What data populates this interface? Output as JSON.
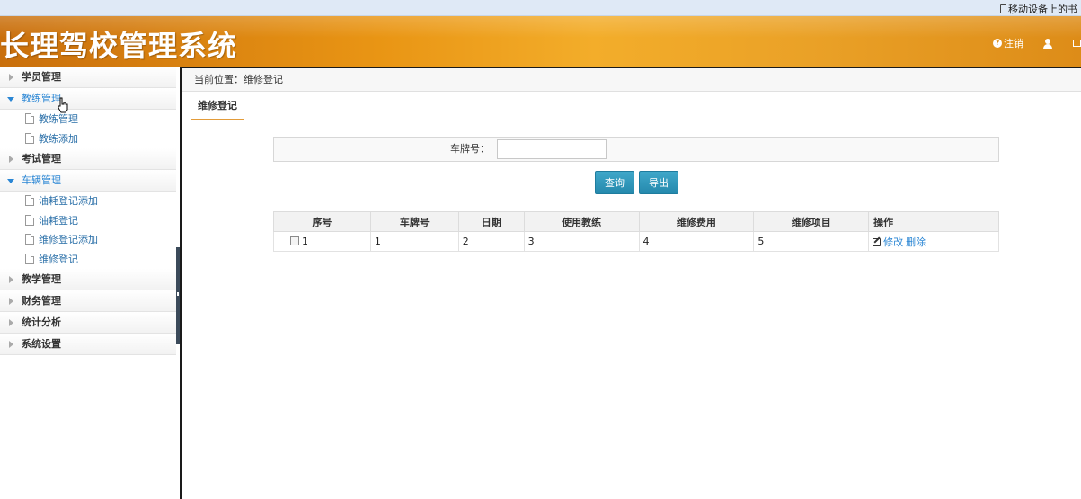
{
  "top_bar": {
    "mobile_link": "移动设备上的书"
  },
  "header": {
    "app_title": "长理驾校管理系统",
    "logout_label": "注销"
  },
  "sidebar": {
    "menus": [
      {
        "label": "学员管理",
        "open": false,
        "items": []
      },
      {
        "label": "教练管理",
        "open": true,
        "items": [
          "教练管理",
          "教练添加"
        ]
      },
      {
        "label": "考试管理",
        "open": false,
        "items": []
      },
      {
        "label": "车辆管理",
        "open": true,
        "items": [
          "油耗登记添加",
          "油耗登记",
          "维修登记添加",
          "维修登记"
        ]
      },
      {
        "label": "教学管理",
        "open": false,
        "items": []
      },
      {
        "label": "财务管理",
        "open": false,
        "items": []
      },
      {
        "label": "统计分析",
        "open": false,
        "items": []
      },
      {
        "label": "系统设置",
        "open": false,
        "items": []
      }
    ]
  },
  "main": {
    "breadcrumb": "当前位置：维修登记",
    "tab": "维修登记",
    "search": {
      "label": "车牌号：",
      "value": "",
      "placeholder": ""
    },
    "buttons": {
      "query": "查询",
      "export": "导出"
    },
    "table": {
      "headers": [
        "序号",
        "车牌号",
        "日期",
        "使用教练",
        "维修费用",
        "维修项目",
        "操作"
      ],
      "rows": [
        {
          "cells": [
            "1",
            "1",
            "2",
            "3",
            "4",
            "5"
          ],
          "actions": [
            "修改",
            "删除"
          ]
        }
      ]
    }
  }
}
